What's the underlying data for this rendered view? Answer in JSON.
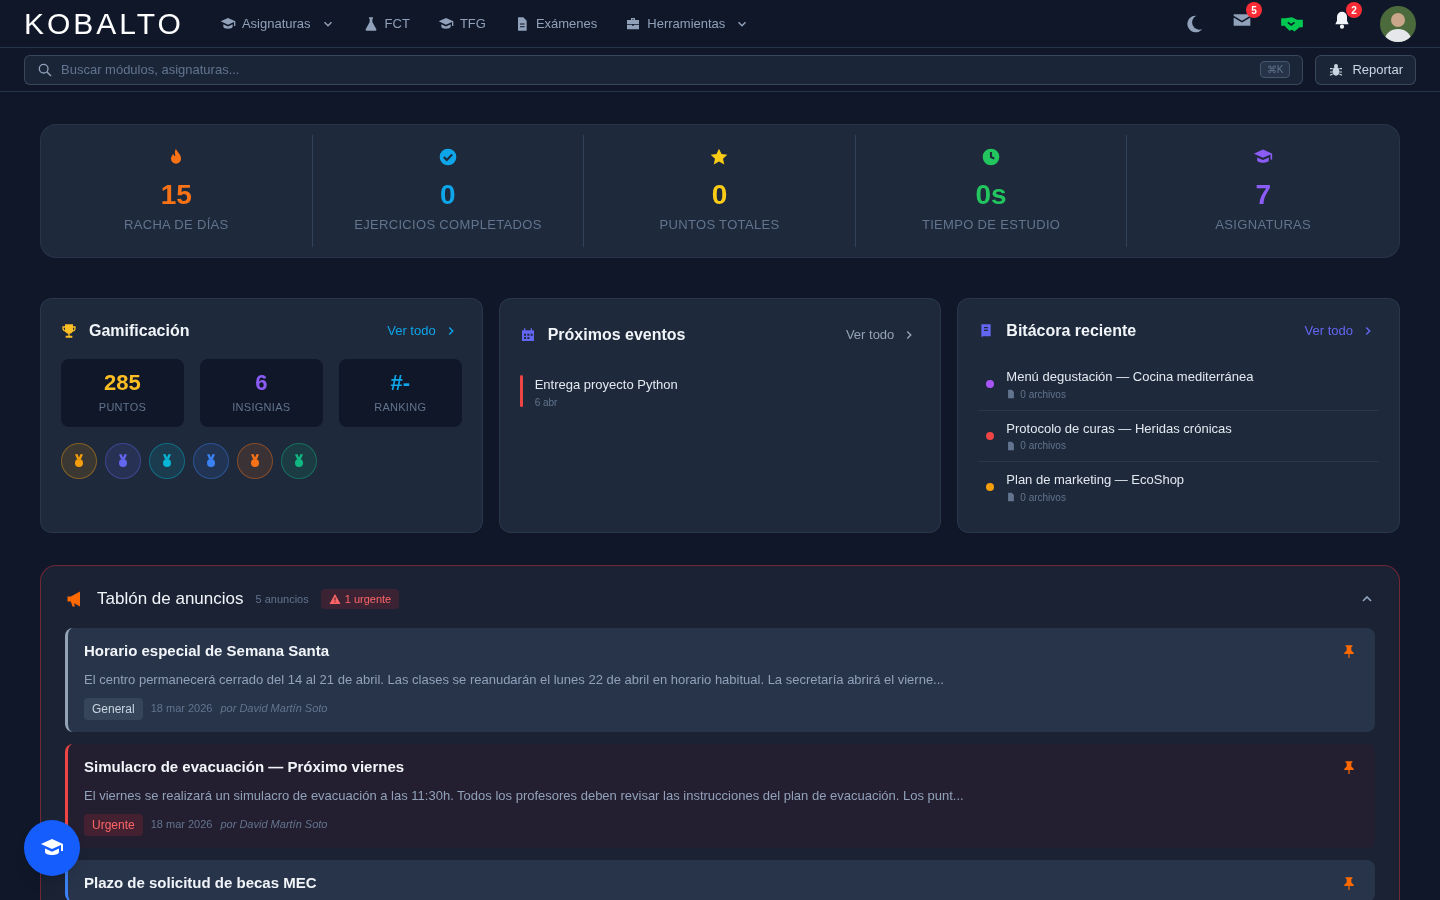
{
  "header": {
    "logo": "KOBALTO",
    "nav": [
      {
        "label": "Asignaturas",
        "dropdown": true
      },
      {
        "label": "FCT",
        "dropdown": false
      },
      {
        "label": "TFG",
        "dropdown": false
      },
      {
        "label": "Exámenes",
        "dropdown": false
      },
      {
        "label": "Herramientas",
        "dropdown": true
      }
    ],
    "mail_badge": "5",
    "bell_badge": "2"
  },
  "search": {
    "placeholder": "Buscar módulos, asignaturas...",
    "shortcut": "⌘K"
  },
  "report_button": "Reportar",
  "stats": [
    {
      "value": "15",
      "label": "RACHA DE DÍAS",
      "color": "#f97316"
    },
    {
      "value": "0",
      "label": "EJERCICIOS COMPLETADOS",
      "color": "#0ea5e9"
    },
    {
      "value": "0",
      "label": "PUNTOS TOTALES",
      "color": "#facc15"
    },
    {
      "value": "0s",
      "label": "TIEMPO DE ESTUDIO",
      "color": "#22c55e"
    },
    {
      "value": "7",
      "label": "ASIGNATURAS",
      "color": "#8b5cf6"
    }
  ],
  "gamification": {
    "title": "Gamificación",
    "link": "Ver todo",
    "tiles": [
      {
        "value": "285",
        "label": "PUNTOS",
        "color": "#fbbf24"
      },
      {
        "value": "6",
        "label": "INSIGNIAS",
        "color": "#8b5cf6"
      },
      {
        "value": "#-",
        "label": "RANKING",
        "color": "#0ea5e9"
      }
    ],
    "badges": [
      {
        "color": "#f59e0b"
      },
      {
        "color": "#6366f1"
      },
      {
        "color": "#06b6d4"
      },
      {
        "color": "#3b82f6"
      },
      {
        "color": "#f97316"
      },
      {
        "color": "#10b981"
      }
    ]
  },
  "events": {
    "title": "Próximos eventos",
    "link": "Ver todo",
    "items": [
      {
        "title": "Entrega proyecto Python",
        "date": "6 abr",
        "color": "#ef4444"
      }
    ]
  },
  "logbook": {
    "title": "Bitácora reciente",
    "link": "Ver todo",
    "items": [
      {
        "title": "Menú degustación — Cocina mediterránea",
        "files": "0 archivos",
        "color": "#a855f7"
      },
      {
        "title": "Protocolo de curas — Heridas crónicas",
        "files": "0 archivos",
        "color": "#ef4444"
      },
      {
        "title": "Plan de marketing — EcoShop",
        "files": "0 archivos",
        "color": "#f59e0b"
      }
    ]
  },
  "announcements": {
    "title": "Tablón de anuncios",
    "count": "5 anuncios",
    "urgent": "1 urgente",
    "expanded": true,
    "items": [
      {
        "kind": "general",
        "title": "Horario especial de Semana Santa",
        "body": "El centro permanecerá cerrado del 14 al 21 de abril. Las clases se reanudarán el lunes 22 de abril en horario habitual. La secretaría abrirá el vierne...",
        "tag": "General",
        "date": "18 mar 2026",
        "author": "por David Martín Soto",
        "pinned": true
      },
      {
        "kind": "urgent",
        "title": "Simulacro de evacuación — Próximo viernes",
        "body": "El viernes se realizará un simulacro de evacuación a las 11:30h. Todos los profesores deben revisar las instrucciones del plan de evacuación. Los punt...",
        "tag": "Urgente",
        "date": "18 mar 2026",
        "author": "por David Martín Soto",
        "pinned": true
      },
      {
        "kind": "info",
        "title": "Plazo de solicitud de becas MEC",
        "pinned": true
      }
    ]
  }
}
